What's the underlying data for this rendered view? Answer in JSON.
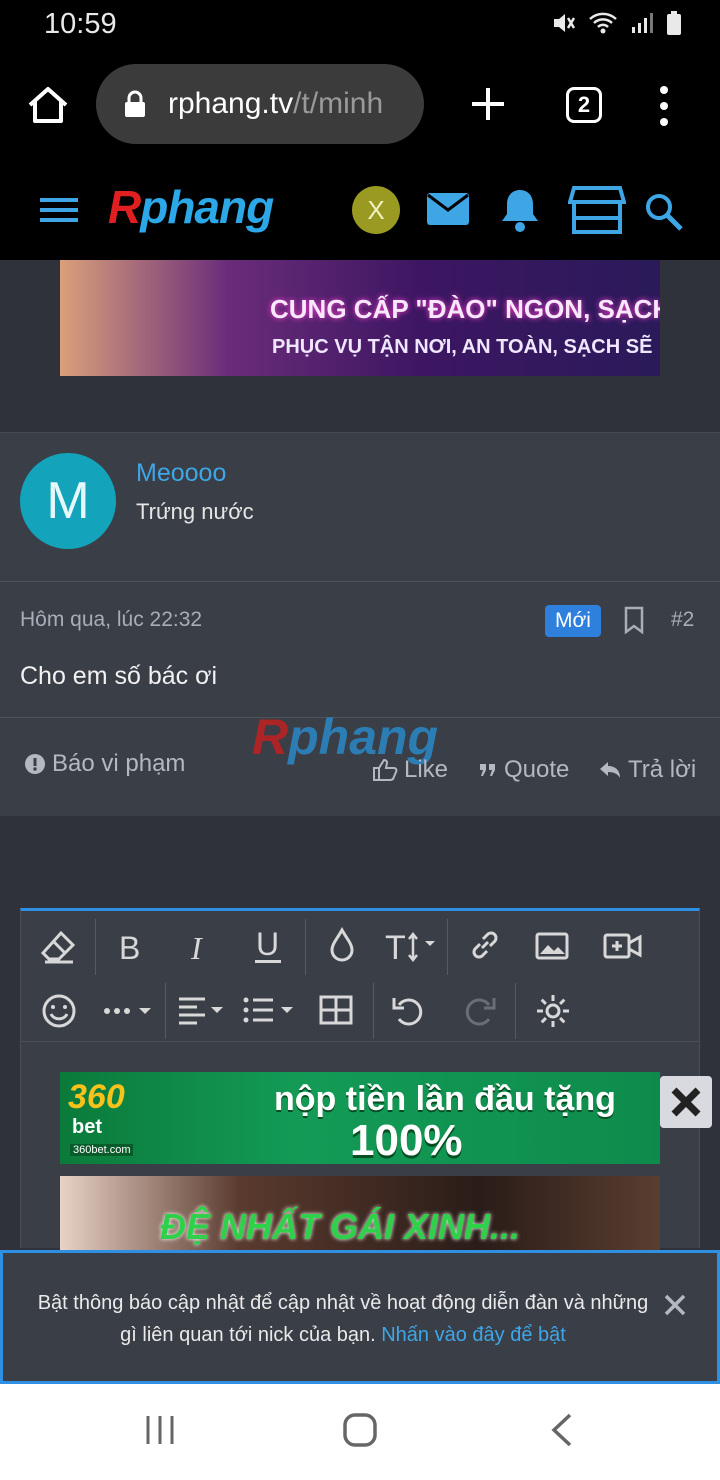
{
  "status_bar": {
    "time": "10:59"
  },
  "browser": {
    "url_host": "rphang.tv",
    "url_rest": "/t/minh",
    "tab_count": "2"
  },
  "site": {
    "logo_r": "R",
    "logo_rest": "phang",
    "user_initial": "X"
  },
  "banner_top": {
    "line1": "CUNG CẤP \"ĐÀO\" NGON, SẠCH",
    "line2": "PHỤC VỤ TẬN NƠI, AN TOÀN, SẠCH SẼ"
  },
  "post": {
    "author_initial": "M",
    "author_name": "Meoooo",
    "author_title": "Trứng nước",
    "date": "Hôm qua, lúc 22:32",
    "badge": "Mới",
    "number": "#2",
    "body": "Cho em số bác ơi",
    "actions": {
      "report": "Báo vi phạm",
      "like": "Like",
      "quote": "Quote",
      "reply": "Trả lời"
    }
  },
  "ads": {
    "ad1_brand": "360",
    "ad1_brand2": "bet",
    "ad1_domain": "360bet.com",
    "ad1_line1": "nộp tiền lần đầu tặng",
    "ad1_line2": "100%",
    "ad2_text": "ĐỆ NHẤT GÁI XINH..."
  },
  "notification": {
    "text": "Bật thông báo cập nhật để cập nhật về hoạt động diễn đàn và những gì liên quan tới nick của bạn.",
    "link": "Nhấn vào đây để bật"
  },
  "colors": {
    "accent": "#2f8fe2",
    "link": "#3fa6e6",
    "badge": "#2f7fdd",
    "avatar_m": "#13a3ba"
  }
}
